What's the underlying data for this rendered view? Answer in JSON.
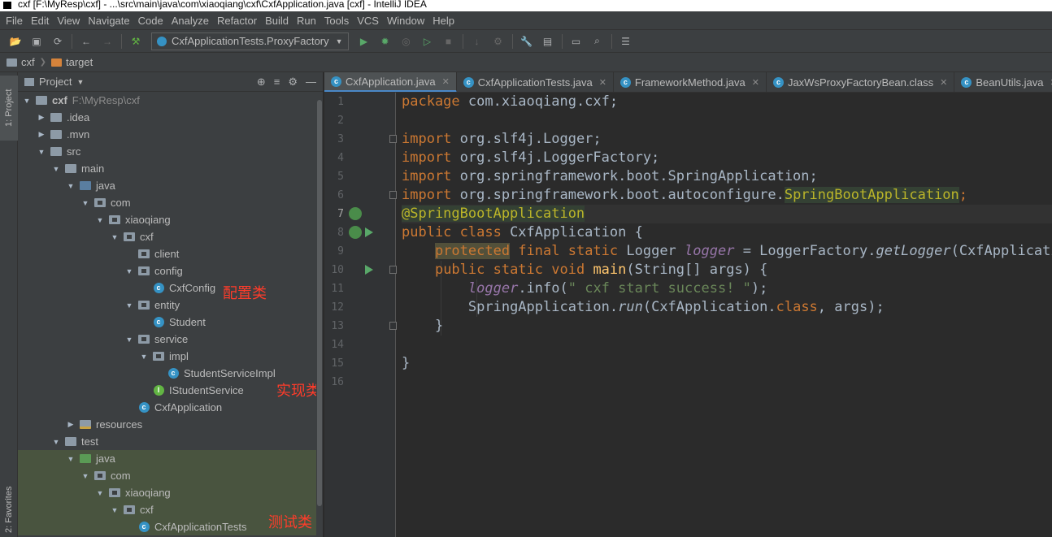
{
  "window": {
    "title": "cxf [F:\\MyResp\\cxf] - ...\\src\\main\\java\\com\\xiaoqiang\\cxf\\CxfApplication.java [cxf] - IntelliJ IDEA"
  },
  "menu": [
    "File",
    "Edit",
    "View",
    "Navigate",
    "Code",
    "Analyze",
    "Refactor",
    "Build",
    "Run",
    "Tools",
    "VCS",
    "Window",
    "Help"
  ],
  "toolbar": {
    "run_config": "CxfApplicationTests.ProxyFactory"
  },
  "navbar": {
    "crumbs": [
      "cxf",
      "target"
    ]
  },
  "left_strip": {
    "project_tab": "1: Project",
    "favorites_tab": "2: Favorites"
  },
  "project_panel": {
    "title": "Project",
    "tree": [
      {
        "label": "cxf",
        "path": "F:\\MyResp\\cxf",
        "depth": 0,
        "arrow": "open",
        "icon": "folder",
        "bold": true
      },
      {
        "label": ".idea",
        "depth": 1,
        "arrow": "closed",
        "icon": "folder"
      },
      {
        "label": ".mvn",
        "depth": 1,
        "arrow": "closed",
        "icon": "folder"
      },
      {
        "label": "src",
        "depth": 1,
        "arrow": "open",
        "icon": "folder"
      },
      {
        "label": "main",
        "depth": 2,
        "arrow": "open",
        "icon": "folder"
      },
      {
        "label": "java",
        "depth": 3,
        "arrow": "open",
        "icon": "src"
      },
      {
        "label": "com",
        "depth": 4,
        "arrow": "open",
        "icon": "pkg"
      },
      {
        "label": "xiaoqiang",
        "depth": 5,
        "arrow": "open",
        "icon": "pkg"
      },
      {
        "label": "cxf",
        "depth": 6,
        "arrow": "open",
        "icon": "pkg"
      },
      {
        "label": "client",
        "depth": 7,
        "arrow": "none",
        "icon": "pkg"
      },
      {
        "label": "config",
        "depth": 7,
        "arrow": "open",
        "icon": "pkg"
      },
      {
        "label": "CxfConfig",
        "depth": 8,
        "arrow": "none",
        "icon": "class"
      },
      {
        "label": "entity",
        "depth": 7,
        "arrow": "open",
        "icon": "pkg"
      },
      {
        "label": "Student",
        "depth": 8,
        "arrow": "none",
        "icon": "class"
      },
      {
        "label": "service",
        "depth": 7,
        "arrow": "open",
        "icon": "pkg"
      },
      {
        "label": "impl",
        "depth": 8,
        "arrow": "open",
        "icon": "pkg"
      },
      {
        "label": "StudentServiceImpl",
        "depth": 9,
        "arrow": "none",
        "icon": "class"
      },
      {
        "label": "IStudentService",
        "depth": 8,
        "arrow": "none",
        "icon": "interface"
      },
      {
        "label": "CxfApplication",
        "depth": 7,
        "arrow": "none",
        "icon": "class"
      },
      {
        "label": "resources",
        "depth": 3,
        "arrow": "closed",
        "icon": "res"
      },
      {
        "label": "test",
        "depth": 2,
        "arrow": "open",
        "icon": "folder"
      },
      {
        "label": "java",
        "depth": 3,
        "arrow": "open",
        "icon": "test",
        "highlight": true
      },
      {
        "label": "com",
        "depth": 4,
        "arrow": "open",
        "icon": "pkg",
        "highlight": true
      },
      {
        "label": "xiaoqiang",
        "depth": 5,
        "arrow": "open",
        "icon": "pkg",
        "highlight": true
      },
      {
        "label": "cxf",
        "depth": 6,
        "arrow": "open",
        "icon": "pkg",
        "highlight": true
      },
      {
        "label": "CxfApplicationTests",
        "depth": 7,
        "arrow": "none",
        "icon": "class",
        "highlight": true
      }
    ],
    "annotations": {
      "config": "配置类",
      "impl": "实现类",
      "test": "测试类"
    }
  },
  "editor_tabs": [
    {
      "label": "CxfApplication.java",
      "active": true
    },
    {
      "label": "CxfApplicationTests.java",
      "active": false
    },
    {
      "label": "FrameworkMethod.java",
      "active": false
    },
    {
      "label": "JaxWsProxyFactoryBean.class",
      "active": false
    },
    {
      "label": "BeanUtils.java",
      "active": false
    }
  ],
  "editor": {
    "line_numbers": [
      "1",
      "2",
      "3",
      "4",
      "5",
      "6",
      "7",
      "8",
      "9",
      "10",
      "11",
      "12",
      "13",
      "14",
      "15",
      "16"
    ],
    "caret_line": 7,
    "code": {
      "l1_kw": "package",
      "l1_rest": " com.xiaoqiang.cxf;",
      "l3_kw": "import",
      "l3_rest": " org.slf4j.Logger;",
      "l4_kw": "import",
      "l4_rest": " org.slf4j.LoggerFactory;",
      "l5_kw": "import",
      "l5_rest": " org.springframework.boot.SpringApplication;",
      "l6_kw": "import",
      "l6_rest": " org.springframework.boot.autoconfigure.",
      "l6_ann": "SpringBootApplication",
      "l6_end": ";",
      "l7_ann": "@SpringBootApplication",
      "l8_kw": "public class",
      "l8_rest": " CxfApplication {",
      "l9_indent": "    ",
      "l9_prot": "protected",
      "l9_kw": " final static",
      "l9_type": " Logger ",
      "l9_field": "logger",
      "l9_eq": " = LoggerFactory.",
      "l9_method": "getLogger",
      "l9_end": "(CxfApplication.class);",
      "l10_indent": "    ",
      "l10_kw": "public static void",
      "l10_sp": " ",
      "l10_method": "main",
      "l10_rest": "(String[] args) {",
      "l11_indent": "        ",
      "l11_field": "logger",
      "l11_mid": ".info(",
      "l11_str": "\" cxf start success! \"",
      "l11_end": ");",
      "l12_indent": "        ",
      "l12_a": "SpringApplication.",
      "l12_run": "run",
      "l12_b": "(CxfApplication.",
      "l12_kw": "class",
      "l12_c": ", args);",
      "l13": "    }",
      "l15": "}"
    }
  }
}
